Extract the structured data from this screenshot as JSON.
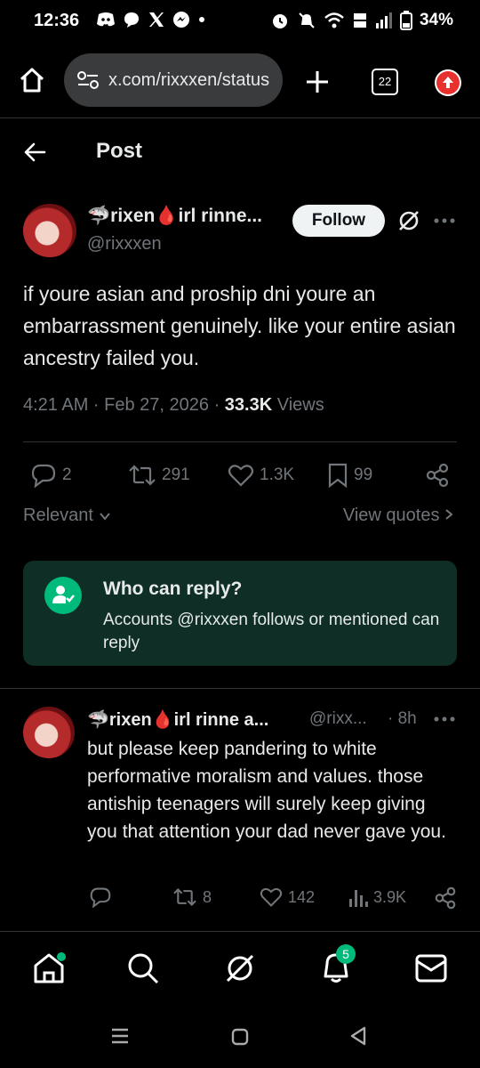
{
  "status_bar": {
    "time": "12:36",
    "battery": "34%",
    "left_icons": [
      "discord-icon",
      "chat-bubble-icon",
      "x-logo-icon",
      "messenger-icon",
      "dot-icon"
    ],
    "right_icons": [
      "alarm-icon",
      "bell-muted-icon",
      "wifi-icon",
      "volte-icon",
      "signal-icon",
      "battery-icon"
    ]
  },
  "browser": {
    "url": "x.com/rixxxen/status",
    "tab_count": "22"
  },
  "header": {
    "title": "Post"
  },
  "post": {
    "display_name": "🦈rixen🩸irl rinne...",
    "handle": "@rixxxen",
    "follow_label": "Follow",
    "text": "if youre asian and proship dni youre an embarrassment genuinely. like your entire asian ancestry failed you.",
    "time": "4:21 AM · Feb 27, 2026 · ",
    "views_count": "33.3K",
    "views_label": " Views",
    "stats": {
      "replies": "2",
      "reposts": "291",
      "likes": "1.3K",
      "bookmarks": "99"
    }
  },
  "sort": {
    "relevant_label": "Relevant",
    "view_quotes_label": "View quotes"
  },
  "who_can_reply": {
    "title": "Who can reply?",
    "description": "Accounts @rixxxen follows or mentioned can reply"
  },
  "reply": {
    "display_name": "🦈rixen🩸irl rinne a...",
    "handle": "@rixx...",
    "time": "· 8h",
    "text": "but please keep pandering to white performative moralism and values. those antiship teenagers will surely keep giving you that attention your dad never gave you.",
    "stats": {
      "replies": "",
      "reposts": "8",
      "likes": "142",
      "views": "3.9K"
    }
  },
  "bottom_nav": {
    "notification_badge": "5"
  },
  "colors": {
    "background": "#000000",
    "text": "#e7e9ea",
    "muted": "#71767b",
    "accent_green": "#00ba7c",
    "who_can_reply_bg": "#0e2e26",
    "notification_red": "#e0245e"
  }
}
